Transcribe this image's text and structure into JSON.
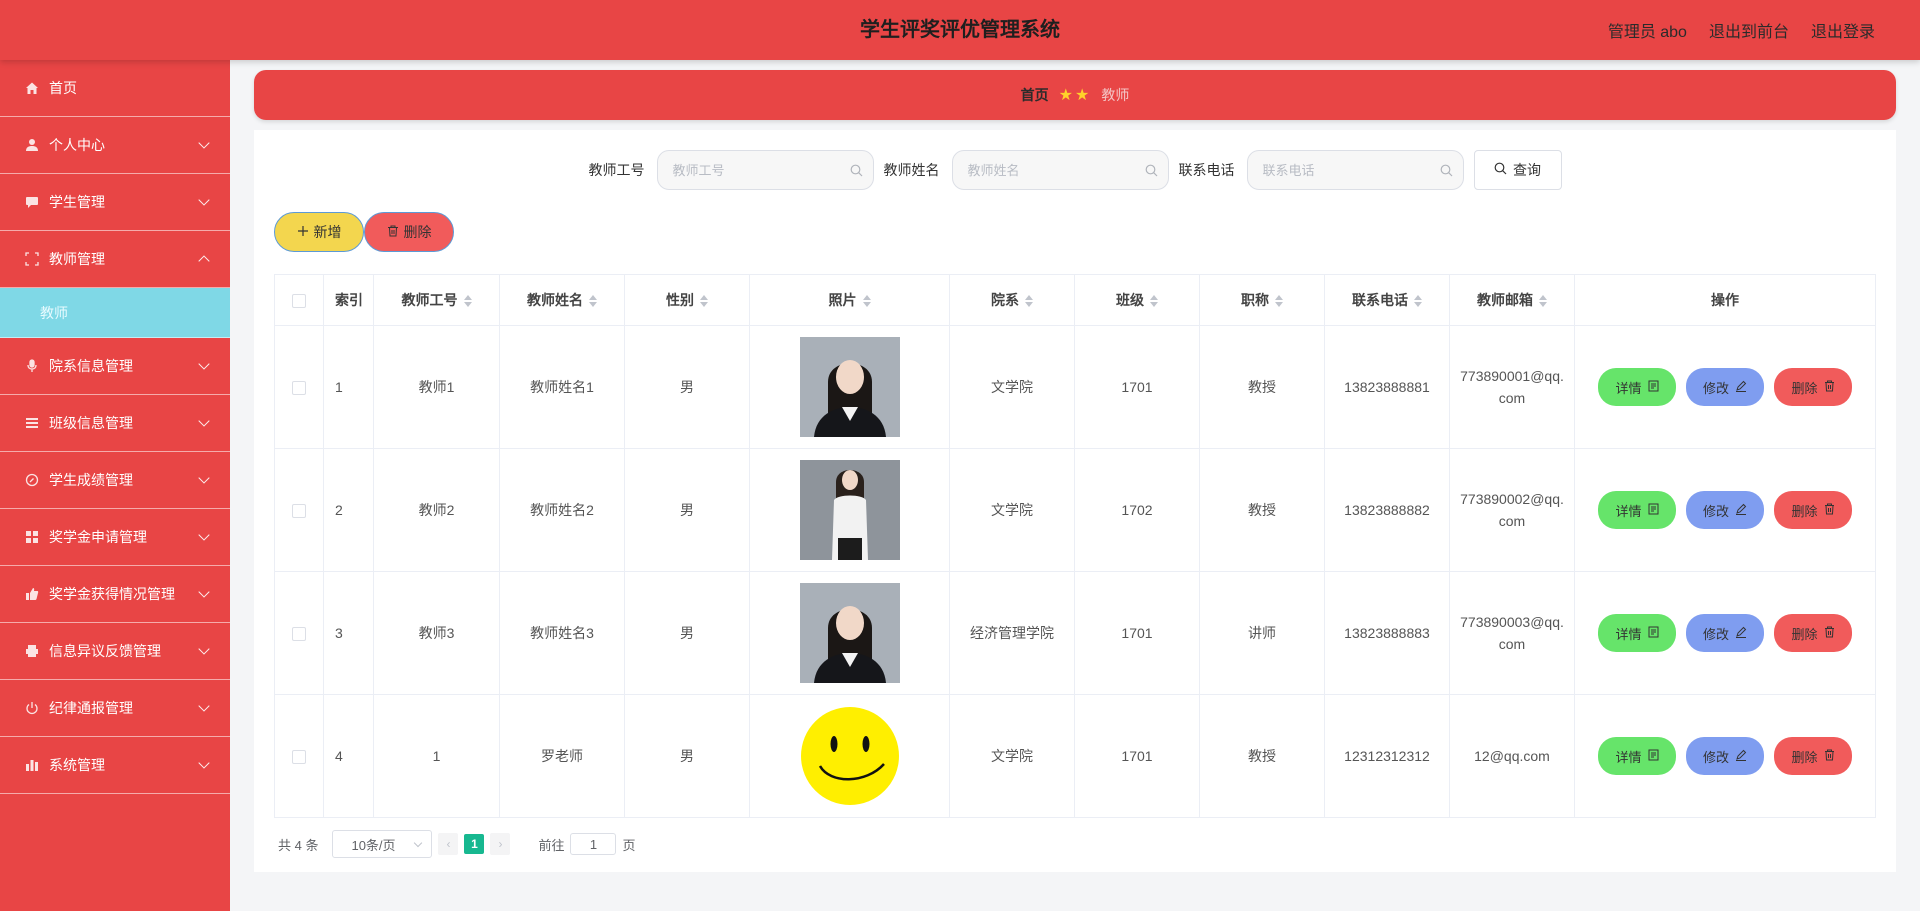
{
  "header": {
    "title": "学生评奖评优管理系统",
    "user_label": "管理员 abo",
    "to_front_label": "退出到前台",
    "logout_label": "退出登录"
  },
  "sidebar": {
    "items": [
      {
        "label": "首页",
        "icon": "home-icon"
      },
      {
        "label": "个人中心",
        "icon": "user-icon"
      },
      {
        "label": "学生管理",
        "icon": "chat-icon"
      },
      {
        "label": "教师管理",
        "icon": "frame-icon",
        "expanded": true,
        "sub": [
          "教师"
        ]
      },
      {
        "label": "院系信息管理",
        "icon": "mic-icon"
      },
      {
        "label": "班级信息管理",
        "icon": "menu-icon"
      },
      {
        "label": "学生成绩管理",
        "icon": "compass-icon"
      },
      {
        "label": "奖学金申请管理",
        "icon": "grid-icon"
      },
      {
        "label": "奖学金获得情况管理",
        "icon": "thumb-icon"
      },
      {
        "label": "信息异议反馈管理",
        "icon": "printer-icon"
      },
      {
        "label": "纪律通报管理",
        "icon": "power-icon"
      },
      {
        "label": "系统管理",
        "icon": "chart-icon"
      }
    ]
  },
  "breadcrumb": {
    "home": "首页",
    "current": "教师"
  },
  "search": {
    "fields": [
      {
        "label": "教师工号",
        "placeholder": "教师工号",
        "value": ""
      },
      {
        "label": "教师姓名",
        "placeholder": "教师姓名",
        "value": ""
      },
      {
        "label": "联系电话",
        "placeholder": "联系电话",
        "value": ""
      }
    ],
    "query_label": "查询"
  },
  "actions": {
    "add_label": "新增",
    "delete_label": "删除"
  },
  "table": {
    "columns": [
      "索引",
      "教师工号",
      "教师姓名",
      "性别",
      "照片",
      "院系",
      "班级",
      "职称",
      "联系电话",
      "教师邮箱",
      "操作"
    ],
    "rows": [
      {
        "index": "1",
        "id": "教师1",
        "name": "教师姓名1",
        "gender": "男",
        "photo": "portrait-dark",
        "dept": "文学院",
        "class": "1701",
        "title": "教授",
        "phone": "13823888881",
        "email": "773890001@qq.com"
      },
      {
        "index": "2",
        "id": "教师2",
        "name": "教师姓名2",
        "gender": "男",
        "photo": "portrait-light",
        "dept": "文学院",
        "class": "1702",
        "title": "教授",
        "phone": "13823888882",
        "email": "773890002@qq.com"
      },
      {
        "index": "3",
        "id": "教师3",
        "name": "教师姓名3",
        "gender": "男",
        "photo": "portrait-dark",
        "dept": "经济管理学院",
        "class": "1701",
        "title": "讲师",
        "phone": "13823888883",
        "email": "773890003@qq.com"
      },
      {
        "index": "4",
        "id": "1",
        "name": "罗老师",
        "gender": "男",
        "photo": "smiley",
        "dept": "文学院",
        "class": "1701",
        "title": "教授",
        "phone": "12312312312",
        "email": "12@qq.com"
      }
    ],
    "row_actions": {
      "detail": "详情",
      "edit": "修改",
      "remove": "删除"
    }
  },
  "pagination": {
    "total_label": "共 4 条",
    "page_size": "10条/页",
    "current_page": "1",
    "goto_label": "前往",
    "goto_value": "1",
    "page_suffix": "页"
  },
  "colors": {
    "primary": "#e84545",
    "active_sub": "#7fd8e6",
    "add_btn": "#f3d64e",
    "detail_btn": "#66e46a",
    "edit_btn": "#7f9df0",
    "delete_btn": "#f15b5b",
    "page_active": "#17b890"
  }
}
